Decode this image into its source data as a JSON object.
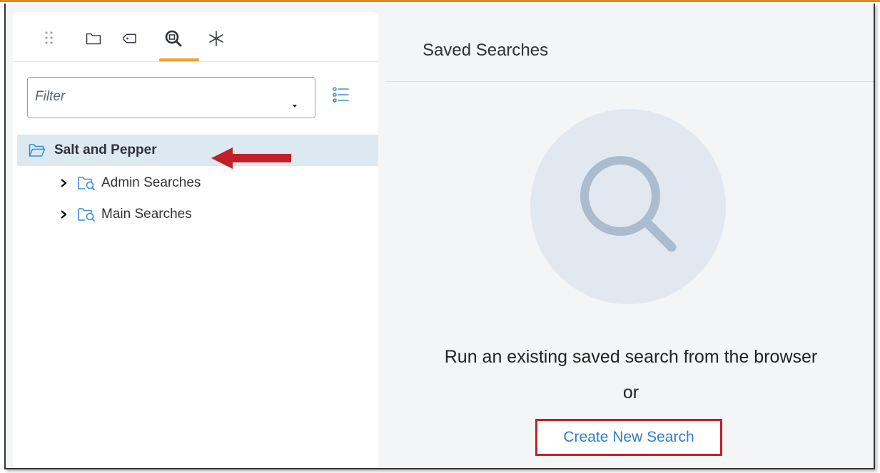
{
  "toolbar": {
    "icons": [
      "drag-handle-icon",
      "folder-icon",
      "tag-icon",
      "saved-search-icon",
      "asterisk-icon"
    ],
    "active_tab": "saved-search-icon"
  },
  "filter": {
    "placeholder": "Filter",
    "value": ""
  },
  "tree": {
    "root": {
      "label": "Salt and Pepper",
      "selected": true
    },
    "children": [
      {
        "label": "Admin Searches",
        "expanded": false
      },
      {
        "label": "Main Searches",
        "expanded": false
      }
    ]
  },
  "main": {
    "title": "Saved Searches",
    "empty_message": "Run an existing saved search from the browser",
    "or_text": "or",
    "create_button_label": "Create New Search"
  },
  "colors": {
    "accent_underline": "#f0a030",
    "selected_row": "#dde9f1",
    "folder_icon": "#3a8fd6",
    "annotation_red": "#c0202a",
    "link_blue": "#2f80c8"
  }
}
